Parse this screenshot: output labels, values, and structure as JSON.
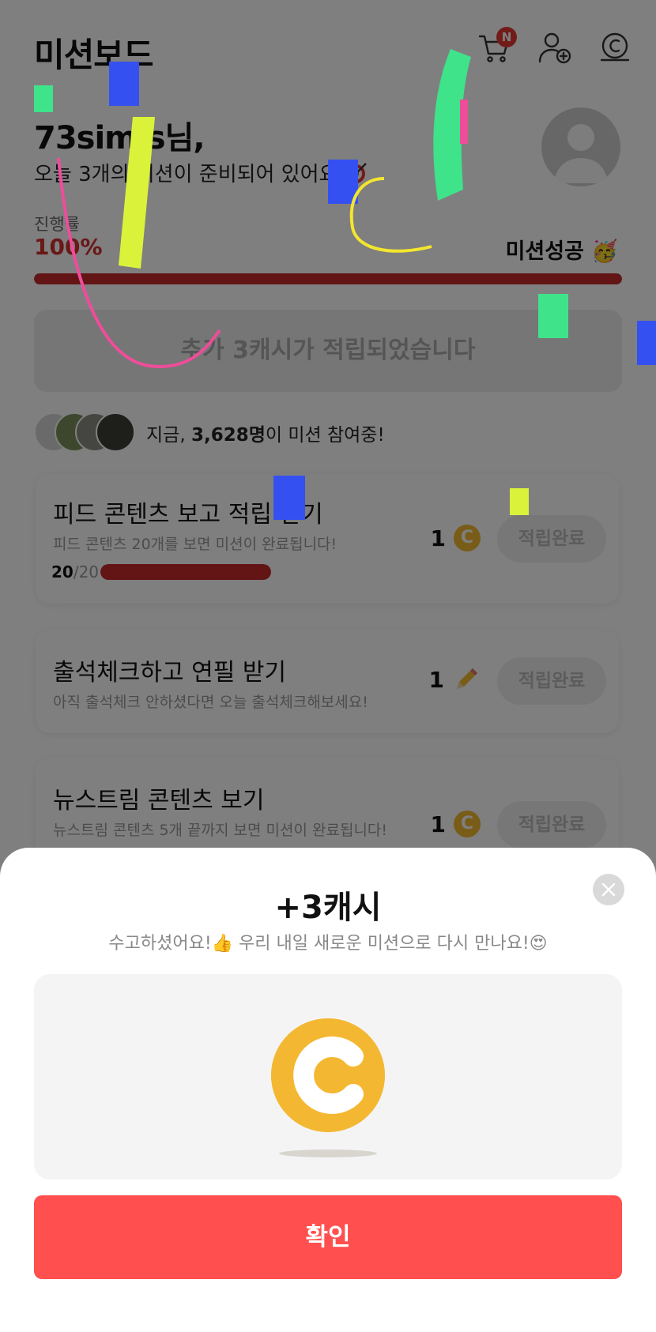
{
  "header": {
    "title": "미션보드",
    "cart_badge": "N",
    "icons": [
      "cart-icon",
      "add-friend-icon",
      "cash-icon"
    ]
  },
  "greeting": {
    "name": "73sim  s님,",
    "subtitle": "오늘 3개의 미션이 준비되어 있어요"
  },
  "progress": {
    "label": "진행률",
    "value": "100%",
    "fraction": 1.0,
    "success_label": "미션성공"
  },
  "notice": {
    "text": "추가 3캐시가 적립되었습니다"
  },
  "participants": {
    "prefix": "지금, ",
    "count": "3,628명",
    "suffix": "이 미션 참여중!"
  },
  "missions": [
    {
      "title": "피드 콘텐츠 보고 적립 받기",
      "desc": "피드 콘텐츠 20개를 보면 미션이 완료됩니다!",
      "reward": "1",
      "reward_icon": "coin-icon",
      "button": "적립완료",
      "progress_done": "20",
      "progress_total": "/20",
      "progress_fraction": 1.0
    },
    {
      "title": "출석체크하고 연필 받기",
      "desc": "아직 출석체크 안하셨다면 오늘 출석체크해보세요!",
      "reward": "1",
      "reward_icon": "pencil-icon",
      "button": "적립완료"
    },
    {
      "title": "뉴스트림 콘텐츠 보기",
      "desc": "뉴스트림 콘텐츠 5개 끝까지 보면 미션이 완료됩니다!",
      "reward": "1",
      "reward_icon": "coin-icon",
      "button": "적립완료"
    }
  ],
  "modal": {
    "title": "+3캐시",
    "subtitle": "수고하셨어요!👍 우리 내일 새로운 미션으로 다시 만나요!😍",
    "confirm": "확인"
  },
  "colors": {
    "accent": "#ff4f4f",
    "progress": "#c62828",
    "coin": "#f4b731"
  }
}
